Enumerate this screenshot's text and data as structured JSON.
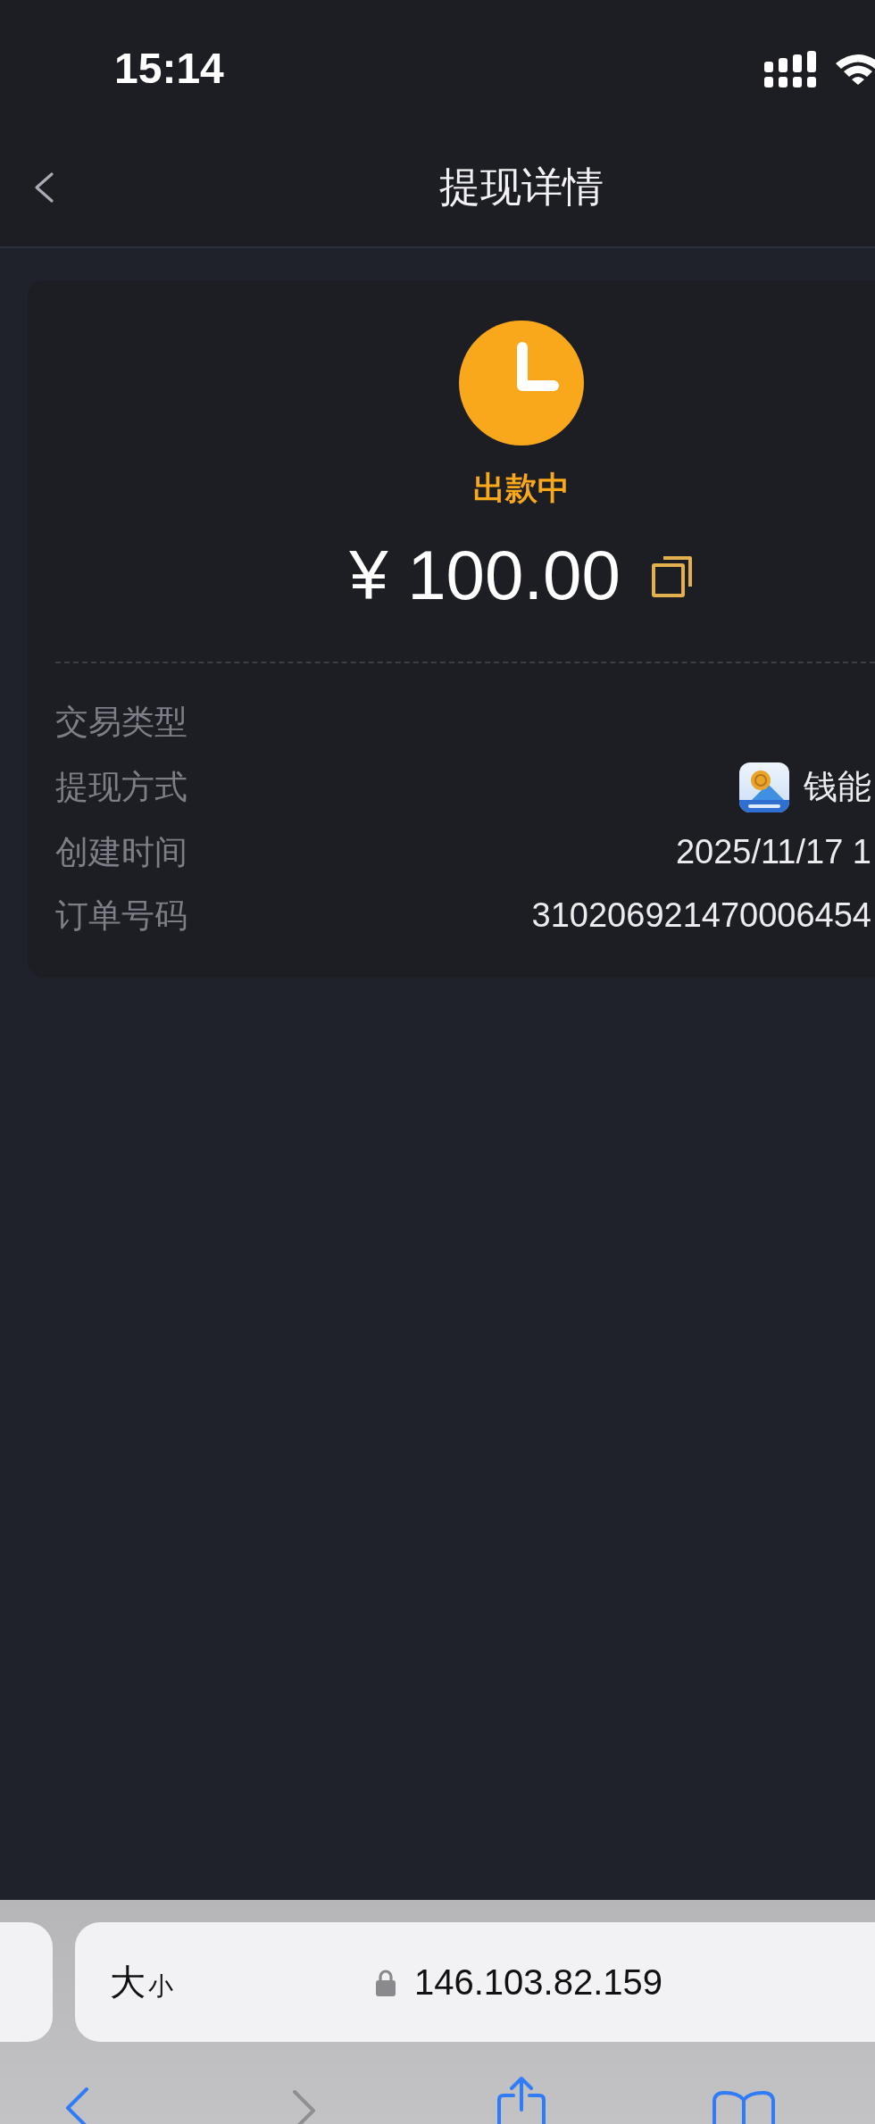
{
  "status_bar": {
    "time": "15:14"
  },
  "nav": {
    "title": "提现详情"
  },
  "status": {
    "kind": "pending",
    "label": "出款中"
  },
  "amount": "¥ 100.00",
  "details": [
    {
      "kind": "text",
      "label": "交易类型"
    },
    {
      "kind": "method",
      "label": "提现方式",
      "value": "钱能"
    },
    {
      "kind": "text",
      "label": "创建时间",
      "value": "2025/11/17 1"
    },
    {
      "kind": "text",
      "label": "订单号码",
      "value": "310206921470006454"
    }
  ],
  "browser": {
    "text_size_button": {
      "large": "大",
      "small": "小"
    },
    "address": "146.103.82.159"
  }
}
